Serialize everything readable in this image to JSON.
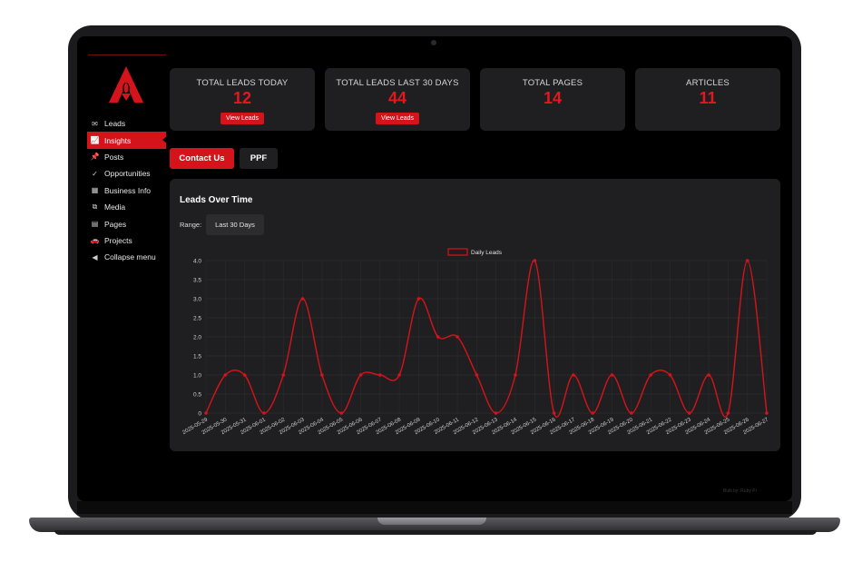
{
  "sidebar": {
    "items": [
      {
        "label": "Leads",
        "icon": "envelope-icon",
        "glyph": "✉",
        "active": false
      },
      {
        "label": "Insights",
        "icon": "chart-line-icon",
        "glyph": "📈",
        "active": true
      },
      {
        "label": "Posts",
        "icon": "pin-icon",
        "glyph": "📌",
        "active": false
      },
      {
        "label": "Opportunities",
        "icon": "check-icon",
        "glyph": "✓",
        "active": false
      },
      {
        "label": "Business Info",
        "icon": "building-icon",
        "glyph": "▦",
        "active": false
      },
      {
        "label": "Media",
        "icon": "media-icon",
        "glyph": "⧉",
        "active": false
      },
      {
        "label": "Pages",
        "icon": "pages-icon",
        "glyph": "▤",
        "active": false
      },
      {
        "label": "Projects",
        "icon": "car-icon",
        "glyph": "🚗",
        "active": false
      },
      {
        "label": "Collapse menu",
        "icon": "collapse-icon",
        "glyph": "◀",
        "active": false
      }
    ]
  },
  "stats": [
    {
      "label": "TOTAL LEADS TODAY",
      "value": "12",
      "button": "View Leads"
    },
    {
      "label": "TOTAL LEADS LAST 30 DAYS",
      "value": "44",
      "button": "View Leads"
    },
    {
      "label": "TOTAL PAGES",
      "value": "14"
    },
    {
      "label": "ARTICLES",
      "value": "11"
    }
  ],
  "tabs": [
    {
      "label": "Contact Us",
      "active": true
    },
    {
      "label": "PPF",
      "active": false
    }
  ],
  "chart_panel": {
    "title": "Leads Over Time",
    "range_label": "Range:",
    "range_value": "Last 30 Days"
  },
  "colors": {
    "accent": "#d4141a",
    "panel": "#1f1f21",
    "background": "#000000"
  },
  "chart_data": {
    "type": "line",
    "title": "",
    "xlabel": "",
    "ylabel": "",
    "ylim": [
      0,
      4
    ],
    "yticks": [
      "0",
      "0.5",
      "1.0",
      "1.5",
      "2.0",
      "2.5",
      "3.0",
      "3.5",
      "4.0"
    ],
    "legend_position": "top-center",
    "grid": true,
    "x": [
      "2025-05-29",
      "2025-05-30",
      "2025-05-31",
      "2025-06-01",
      "2025-06-02",
      "2025-06-03",
      "2025-06-04",
      "2025-06-05",
      "2025-06-06",
      "2025-06-07",
      "2025-06-08",
      "2025-06-09",
      "2025-06-10",
      "2025-06-11",
      "2025-06-12",
      "2025-06-13",
      "2025-06-14",
      "2025-06-15",
      "2025-06-16",
      "2025-06-17",
      "2025-06-18",
      "2025-06-19",
      "2025-06-20",
      "2025-06-21",
      "2025-06-22",
      "2025-06-23",
      "2025-06-24",
      "2025-06-25",
      "2025-06-26",
      "2025-06-27"
    ],
    "series": [
      {
        "name": "Daily Leads",
        "color": "#d4141a",
        "values": [
          0,
          1,
          1,
          0,
          1,
          3,
          1,
          0,
          1,
          1,
          1,
          3,
          2,
          2,
          1,
          0,
          1,
          4,
          0,
          1,
          0,
          1,
          0,
          1,
          1,
          0,
          1,
          0,
          4,
          0
        ]
      }
    ]
  },
  "footer": {
    "text": "Built by: Ruby Pi"
  }
}
